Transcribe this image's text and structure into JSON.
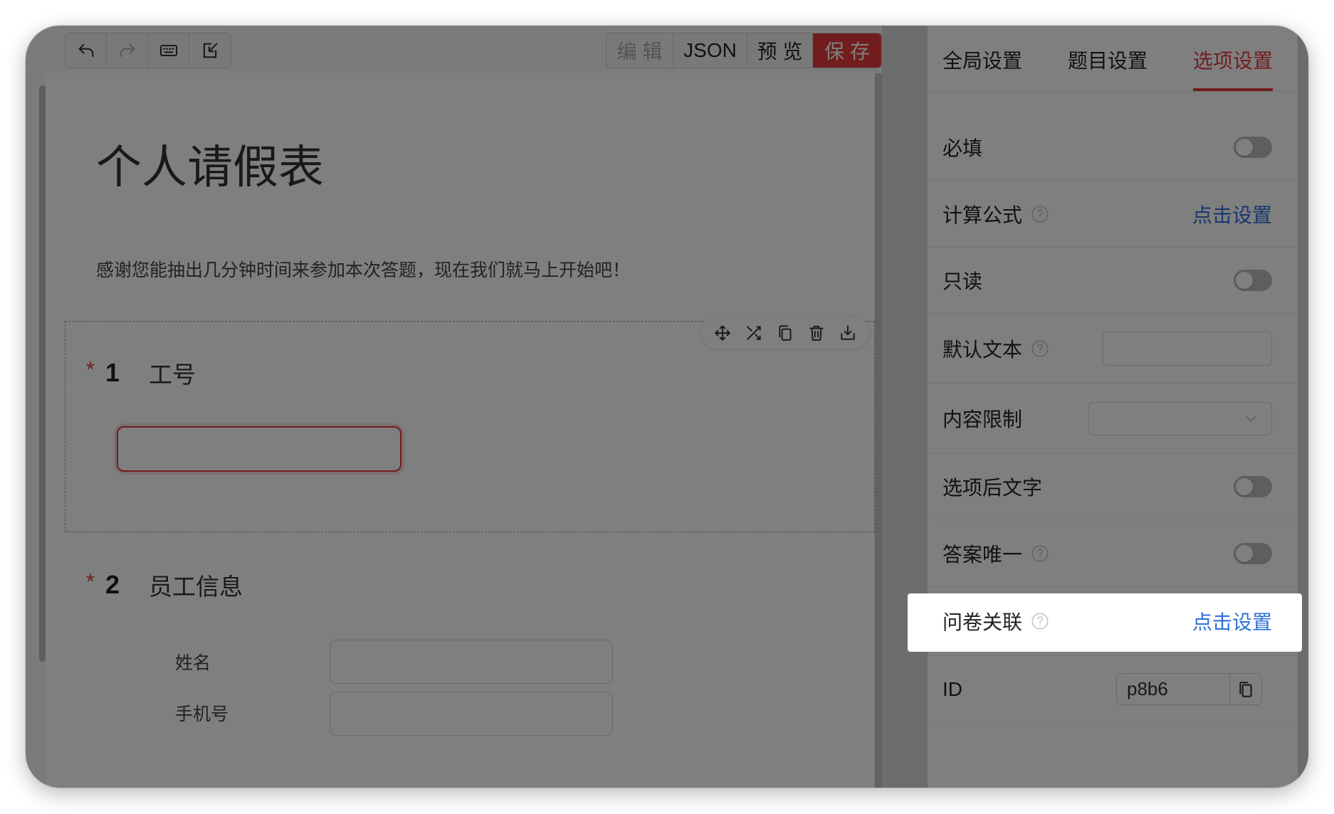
{
  "colors": {
    "accent": "#e23a3a",
    "link": "#2f6fdc",
    "overlay": "rgba(0, 0, 0, 0.5)"
  },
  "toolbar": {
    "history_buttons": [
      {
        "icon": "undo-icon",
        "enabled": true
      },
      {
        "icon": "redo-icon",
        "enabled": false
      },
      {
        "icon": "keyboard-icon",
        "enabled": true
      },
      {
        "icon": "import-icon",
        "enabled": true
      }
    ],
    "mode_buttons": [
      {
        "label": "编 辑",
        "active": true
      },
      {
        "label": "JSON",
        "active": false
      },
      {
        "label": "预 览",
        "active": false
      }
    ],
    "save_label": "保 存"
  },
  "form": {
    "title": "个人请假表",
    "description": "感谢您能抽出几分钟时间来参加本次答题，现在我们就马上开始吧！",
    "required_mark": "*",
    "block_actions": [
      "move-icon",
      "shuffle-icon",
      "copy-icon",
      "delete-icon",
      "download-icon"
    ],
    "questions": [
      {
        "number": "1",
        "title": "工号",
        "required": true,
        "selected": true,
        "value": ""
      },
      {
        "number": "2",
        "title": "员工信息",
        "required": true,
        "fields": [
          {
            "label": "姓名",
            "value": ""
          },
          {
            "label": "手机号",
            "value": ""
          }
        ]
      }
    ]
  },
  "settings": {
    "tabs": [
      {
        "label": "全局设置",
        "active": false
      },
      {
        "label": "题目设置",
        "active": false
      },
      {
        "label": "选项设置",
        "active": true
      }
    ],
    "rows": {
      "required": {
        "label": "必填",
        "on": false
      },
      "formula": {
        "label": "计算公式",
        "link": "点击设置"
      },
      "readonly": {
        "label": "只读",
        "on": false
      },
      "default_text": {
        "label": "默认文本",
        "value": ""
      },
      "content_limit": {
        "label": "内容限制",
        "value": ""
      },
      "suffix_text": {
        "label": "选项后文字",
        "on": false
      },
      "unique_answer": {
        "label": "答案唯一",
        "on": false
      },
      "survey_link": {
        "label": "问卷关联",
        "link": "点击设置",
        "highlighted": true
      },
      "id": {
        "label": "ID",
        "value": "p8b6"
      }
    }
  }
}
